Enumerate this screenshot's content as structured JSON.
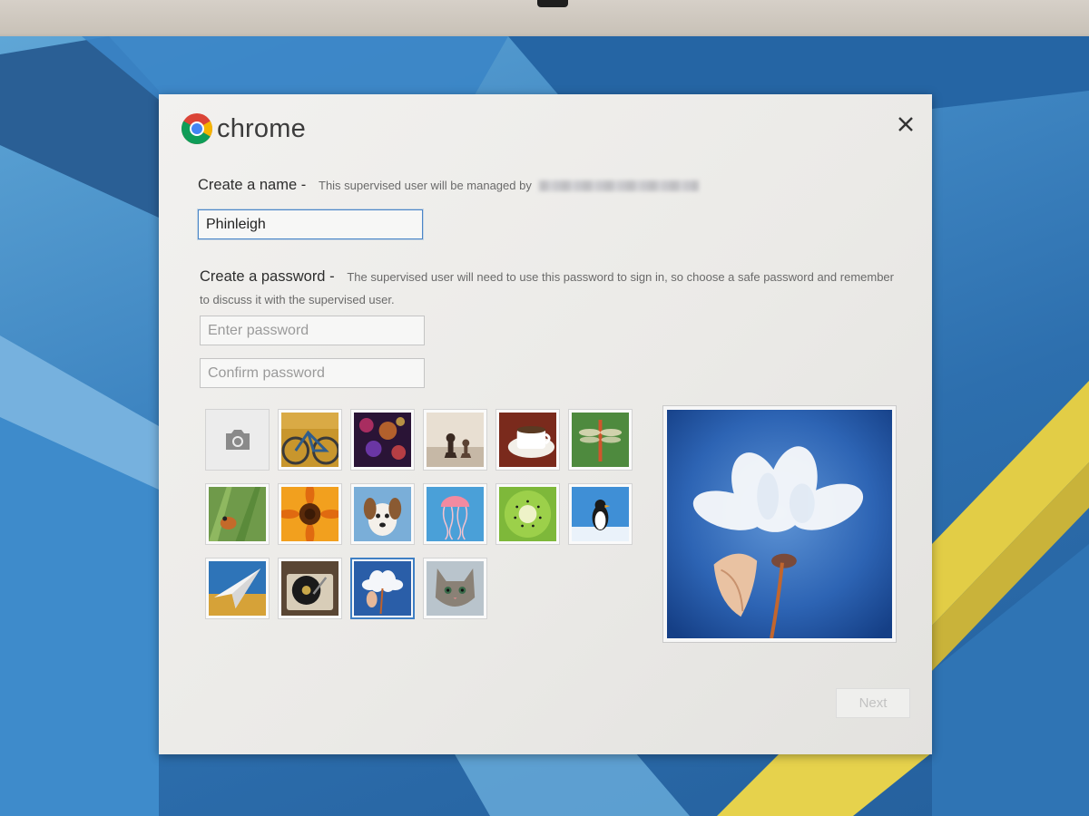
{
  "dialog": {
    "brand": "chrome",
    "name_section": {
      "title": "Create a name -",
      "subtitle": "This supervised user will be managed by",
      "name_value": "Phinleigh"
    },
    "password_section": {
      "title": "Create a password -",
      "subtitle": "The supervised user will need to use this password to sign in, so choose a safe password and remember to discuss it with the supervised user.",
      "password_placeholder": "Enter password",
      "confirm_placeholder": "Confirm password"
    },
    "avatars": [
      {
        "name": "camera",
        "selected": false
      },
      {
        "name": "bicycle",
        "selected": false
      },
      {
        "name": "bokeh-lights",
        "selected": false
      },
      {
        "name": "chess-pieces",
        "selected": false
      },
      {
        "name": "coffee-cup",
        "selected": false
      },
      {
        "name": "dragonfly",
        "selected": false
      },
      {
        "name": "frog",
        "selected": false
      },
      {
        "name": "sunflower",
        "selected": false
      },
      {
        "name": "puppy",
        "selected": false
      },
      {
        "name": "jellyfish",
        "selected": false
      },
      {
        "name": "kiwi",
        "selected": false
      },
      {
        "name": "penguin",
        "selected": false
      },
      {
        "name": "paper-plane",
        "selected": false
      },
      {
        "name": "record-player",
        "selected": false
      },
      {
        "name": "white-flower",
        "selected": true
      },
      {
        "name": "kitten",
        "selected": false
      }
    ],
    "preview": "white-flower",
    "next_label": "Next",
    "close_icon": "close-icon"
  },
  "colors": {
    "accent": "#3f7fc4",
    "dialog_bg": "#efeeeb",
    "wallpaper_blue": "#2d6fae",
    "wallpaper_yellow": "#e6c93a"
  }
}
